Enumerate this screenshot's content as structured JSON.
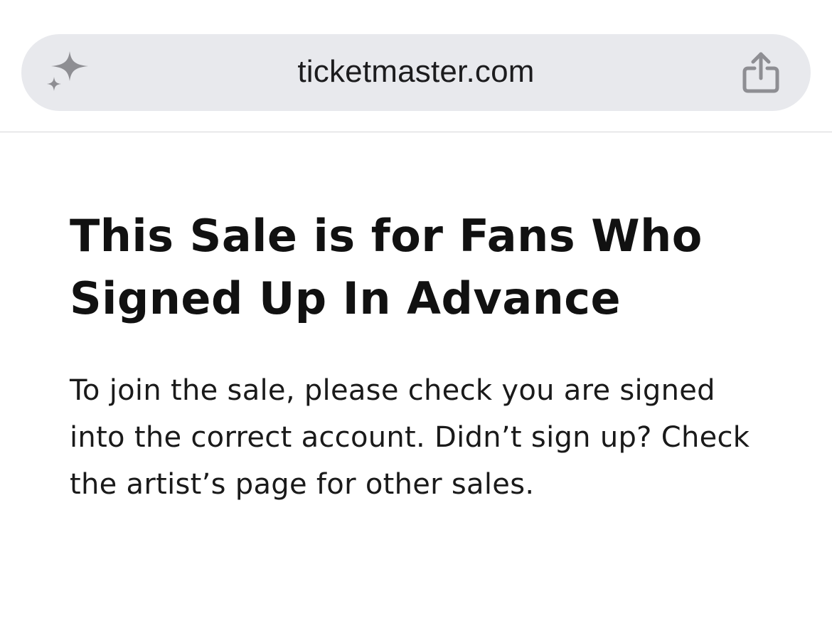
{
  "browser": {
    "url": "ticketmaster.com",
    "left_icon": "sparkle-icon",
    "right_icon": "share-icon"
  },
  "page": {
    "title": "This Sale is for Fans Who Signed Up In Advance",
    "body": "To join the sale, please check you are signed into the correct account. Didn’t sign up? Check the artist’s page for other sales."
  },
  "colors": {
    "address_bar": "#e8e9ed",
    "icon": "#8e8e93",
    "text": "#111111",
    "background": "#ffffff"
  }
}
